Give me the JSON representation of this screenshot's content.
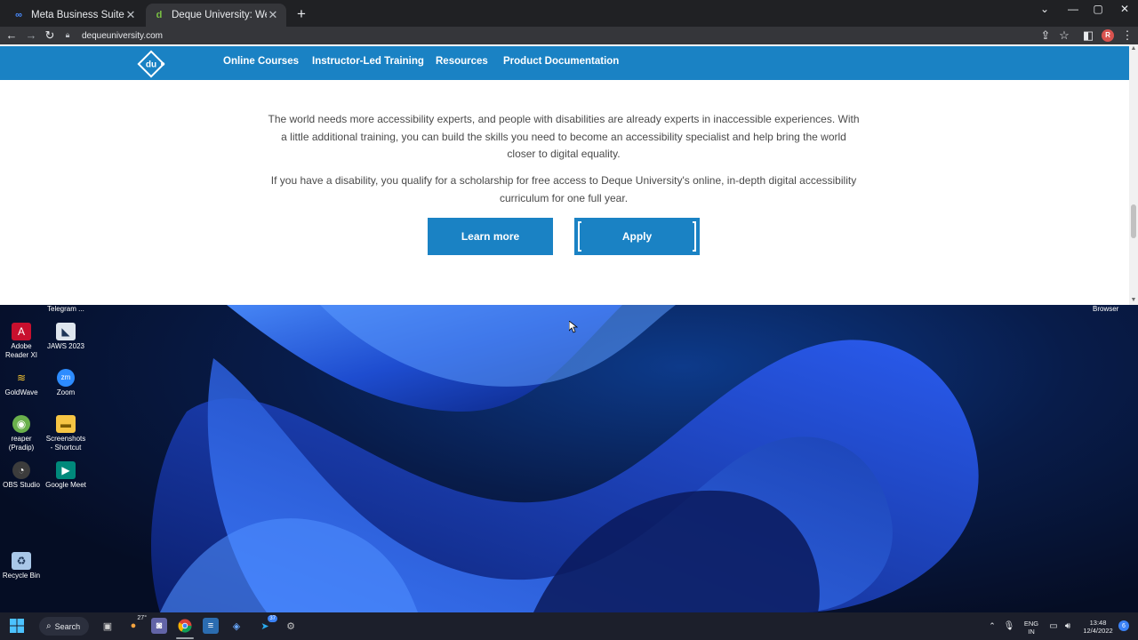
{
  "browser": {
    "tabs": [
      {
        "title": "Meta Business Suite",
        "icon": "meta-icon",
        "active": false
      },
      {
        "title": "Deque University: Web Accessibility",
        "icon": "deque-favicon",
        "active": true
      }
    ],
    "new_tab": "+",
    "window_controls": {
      "minimize": "—",
      "maximize": "▢",
      "close": "✕",
      "chevron": "⌄"
    },
    "url": "dequeuniversity.com",
    "profile_initial": "R"
  },
  "site": {
    "nav": [
      {
        "label": "Online Courses"
      },
      {
        "label": "Instructor-Led Training"
      },
      {
        "label": "Resources"
      },
      {
        "label": "Product Documentation"
      }
    ],
    "paragraphs": [
      "The world needs more accessibility experts, and people with disabilities are already experts in inaccessible experiences. With a little additional training, you can build the skills you need to become an accessibility specialist and help bring the world closer to digital equality.",
      "If you have a disability, you qualify for a scholarship for free access to Deque University's online, in-depth digital accessibility curriculum for one full year."
    ],
    "buttons": {
      "learn_more": "Learn more",
      "apply": "Apply"
    },
    "brand_color": "#1a82c4"
  },
  "desktop": {
    "top_labels": {
      "telegram": "Telegram ...",
      "browser": "Browser"
    },
    "icons": [
      {
        "label": "Adobe Reader XI",
        "icon": "adobe-reader-icon"
      },
      {
        "label": "JAWS 2023",
        "icon": "jaws-icon"
      },
      {
        "label": "GoldWave",
        "icon": "goldwave-icon"
      },
      {
        "label": "Zoom",
        "icon": "zoom-icon"
      },
      {
        "label": "reaper (Pradip)",
        "icon": "reaper-icon"
      },
      {
        "label": "Screenshots - Shortcut",
        "icon": "folder-icon"
      },
      {
        "label": "OBS Studio",
        "icon": "obs-icon"
      },
      {
        "label": "Google Meet",
        "icon": "google-meet-icon"
      },
      {
        "label": "Recycle Bin",
        "icon": "recycle-bin-icon"
      }
    ]
  },
  "taskbar": {
    "search_label": "Search",
    "weather": "27°",
    "telegram_badge": "37",
    "language": "ENG",
    "region": "IN",
    "time": "13:48",
    "date": "12/4/2022",
    "notification_count": "6"
  }
}
